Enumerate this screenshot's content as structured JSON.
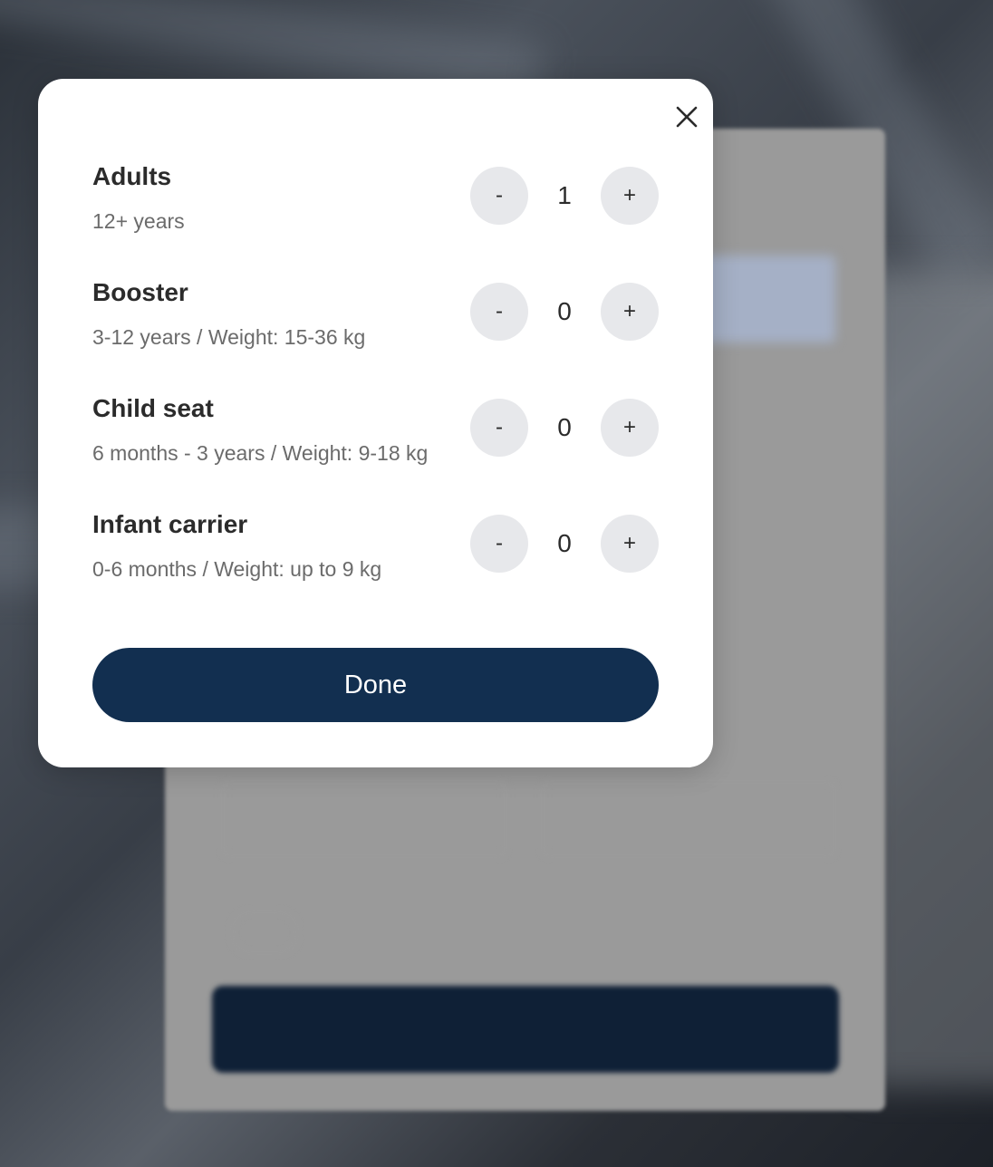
{
  "dialog": {
    "rows": [
      {
        "title": "Adults",
        "subtitle": "12+ years",
        "value": "1",
        "minus": "-",
        "plus": "+"
      },
      {
        "title": "Booster",
        "subtitle": "3-12 years / Weight: 15-36 kg",
        "value": "0",
        "minus": "-",
        "plus": "+"
      },
      {
        "title": "Child seat",
        "subtitle": "6 months - 3 years / Weight: 9-18 kg",
        "value": "0",
        "minus": "-",
        "plus": "+"
      },
      {
        "title": "Infant carrier",
        "subtitle": "0-6 months / Weight: up to 9 kg",
        "value": "0",
        "minus": "-",
        "plus": "+"
      }
    ],
    "done_label": "Done",
    "close_icon": "close-icon"
  },
  "colors": {
    "primary": "#122f50",
    "stepper_bg": "#e7e8eb",
    "text": "#2b2b2b",
    "subtext": "#6b6b6b"
  }
}
